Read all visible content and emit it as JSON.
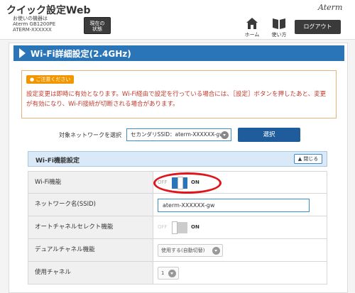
{
  "header": {
    "app_title": "クイック設定Web",
    "device_caption": "お使いの機器は",
    "device_model": "Aterm GB1200PE",
    "device_ssid": "ATERM-XXXXXX",
    "status_button": [
      "現在の",
      "状態"
    ],
    "home_label": "ホーム",
    "howto_label": "使い方",
    "logout_label": "ログアウト",
    "logo": "Aterm"
  },
  "page": {
    "title": "Wi-Fi詳細設定(2.4GHz)"
  },
  "notice": {
    "badge": "ご注意ください",
    "text": "設定変更は即時に有効となります。Wi-Fi経由で設定を行っている場合には、［設定］ボタンを押したあと、変更が有効になり、Wi-Fi接続が切断される場合があります。"
  },
  "network_select": {
    "label": "対象ネットワークを選択",
    "value": "セカンダリSSID：aterm-XXXXXX-gw",
    "button": "選択"
  },
  "section": {
    "title": "Wi-Fi機能設定",
    "close_button": "閉じる"
  },
  "rows": {
    "wifi_function": {
      "label": "Wi-Fi機能",
      "off": "OFF",
      "on": "ON",
      "state": "on"
    },
    "ssid": {
      "label": "ネットワーク名(SSID)",
      "value": "aterm-XXXXXX-gw"
    },
    "auto_channel": {
      "label": "オートチャネルセレクト機能",
      "off": "OFF",
      "on": "ON",
      "state": "off"
    },
    "dual_channel": {
      "label": "デュアルチャネル機能",
      "value": "使用する(自動切替)"
    },
    "channel": {
      "label": "使用チャネル",
      "value": "1"
    }
  },
  "colors": {
    "accent": "#2a75b8",
    "highlight": "#e0141a",
    "notice_text": "#c0392b",
    "badge": "#f29600"
  }
}
